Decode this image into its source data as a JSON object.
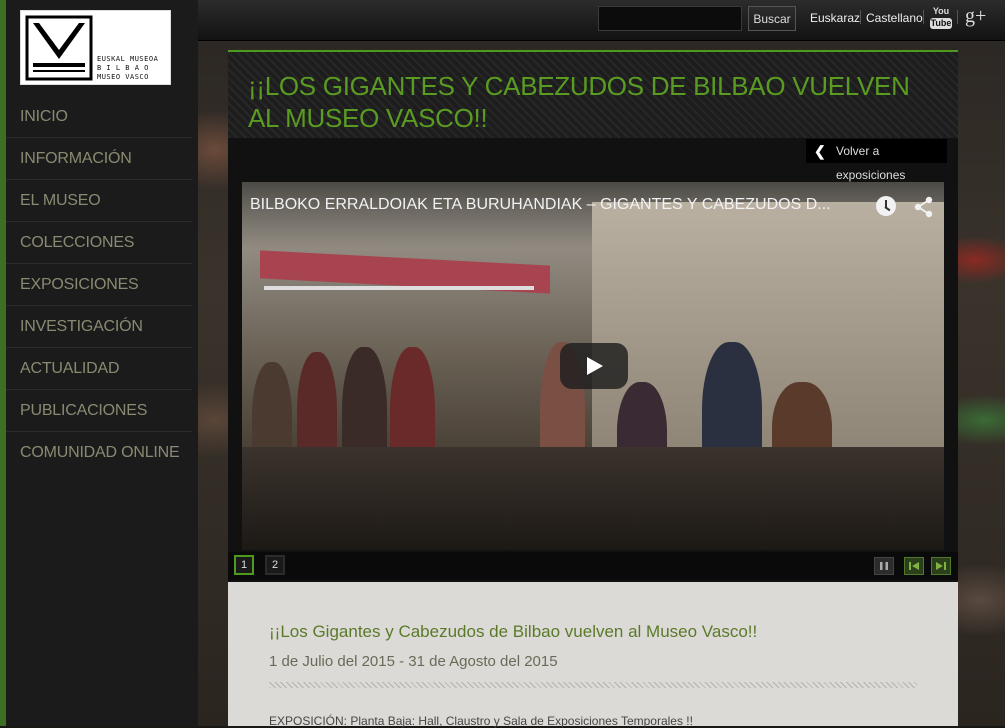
{
  "header": {
    "search": {
      "value": "",
      "placeholder": ""
    },
    "search_button": "Buscar",
    "languages": [
      "Euskaraz",
      "Castellano"
    ],
    "social": {
      "youtube_top": "You",
      "youtube_bottom": "Tube",
      "gplus": "g+"
    }
  },
  "logo": {
    "lines": [
      "EUSKAL MUSEOA",
      "B I L B A O",
      "MUSEO VASCO"
    ]
  },
  "sidebar": {
    "items": [
      {
        "label": "INICIO"
      },
      {
        "label": "INFORMACIÓN"
      },
      {
        "label": "EL MUSEO"
      },
      {
        "label": "COLECCIONES"
      },
      {
        "label": "EXPOSICIONES"
      },
      {
        "label": "INVESTIGACIÓN"
      },
      {
        "label": "ACTUALIDAD"
      },
      {
        "label": "PUBLICACIONES"
      },
      {
        "label": "COMUNIDAD ONLINE"
      }
    ]
  },
  "main": {
    "title": "¡¡LOS GIGANTES Y CABEZUDOS DE BILBAO VUELVEN AL MUSEO VASCO!!",
    "back_button": "Volver a exposiciones",
    "video": {
      "title": "BILBOKO ERRALDOIAK ETA BURUHANDIAK – GIGANTES Y CABEZUDOS D..."
    },
    "slider": {
      "pages": [
        "1",
        "2"
      ],
      "active_page": "1"
    }
  },
  "content": {
    "title": "¡¡Los Gigantes y Cabezudos de Bilbao vuelven al Museo Vasco!!",
    "date": "1 de Julio del 2015 - 31 de Agosto del 2015",
    "text": "EXPOSICIÓN:  Planta Baja: Hall, Claustro y Sala de Exposiciones Temporales !!"
  },
  "colors": {
    "accent_green": "#4e9a1e",
    "title_green": "#5a9b22",
    "sidebar_text": "#8a8a72"
  }
}
